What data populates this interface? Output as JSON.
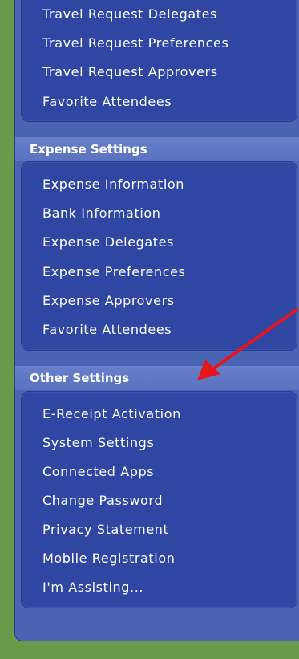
{
  "travel_settings": {
    "items": [
      "Travel Request Delegates",
      "Travel Request Preferences",
      "Travel Request Approvers",
      "Favorite Attendees"
    ]
  },
  "expense_settings": {
    "title": "Expense Settings",
    "items": [
      "Expense Information",
      "Bank Information",
      "Expense Delegates",
      "Expense Preferences",
      "Expense Approvers",
      "Favorite Attendees"
    ]
  },
  "other_settings": {
    "title": "Other Settings",
    "items": [
      "E-Receipt Activation",
      "System Settings",
      "Connected Apps",
      "Change Password",
      "Privacy Statement",
      "Mobile Registration",
      "I'm Assisting..."
    ]
  },
  "colors": {
    "background": "#6b9a4a",
    "panel": "#4a64b4",
    "group_box": "#2f46a2",
    "header": "#6880c8",
    "arrow": "#e8141c"
  }
}
